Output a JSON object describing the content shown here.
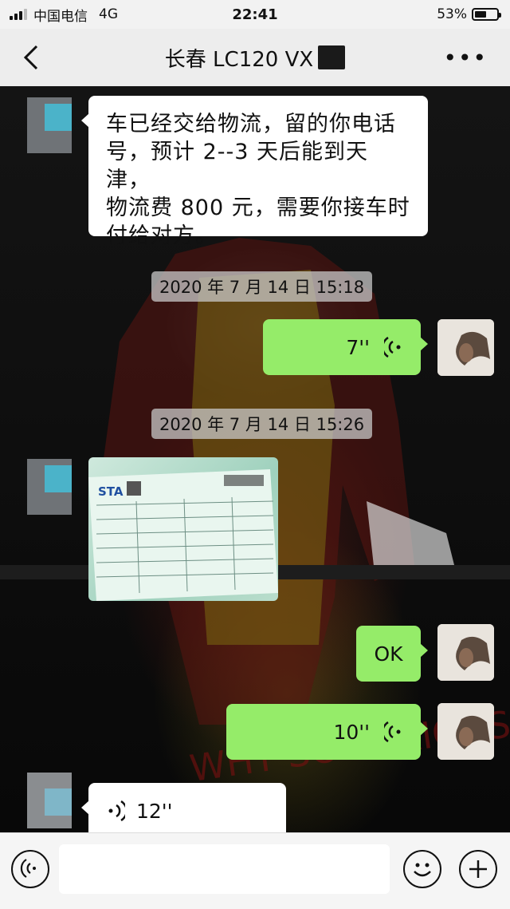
{
  "status_bar": {
    "carrier": "中国电信",
    "network": "4G",
    "time": "22:41",
    "battery": "53%",
    "battery_level": 0.53
  },
  "header": {
    "title": "长春 LC120 VX",
    "back_icon": "chevron-left-icon",
    "more_icon": "more-dots-icon",
    "more_text": "•••"
  },
  "messages": [
    {
      "type": "text",
      "side": "left",
      "text_lines": [
        "车已经交给物流，留的你电话",
        "号，预计 2--3 天后能到天津，",
        "物流费 800 元，需要你接车时",
        "付给对方。"
      ]
    },
    {
      "type": "timestamp",
      "text": "2020 年 7 月 14 日  15:18"
    },
    {
      "type": "voice",
      "side": "right",
      "duration": "7''"
    },
    {
      "type": "timestamp",
      "text": "2020 年 7 月 14 日  15:26"
    },
    {
      "type": "image",
      "side": "left",
      "description_icon": "logistics-receipt-photo"
    },
    {
      "type": "text",
      "side": "right",
      "text": "OK"
    },
    {
      "type": "voice",
      "side": "right",
      "duration": "10''"
    },
    {
      "type": "voice",
      "side": "left",
      "duration": "12''"
    }
  ],
  "input_bar": {
    "voice_icon": "voice-mode-icon",
    "emoji_icon": "emoji-icon",
    "plus_icon": "plus-icon"
  },
  "colors": {
    "green_bubble": "#95ec69",
    "white_bubble": "#ffffff",
    "header_bg": "#ededed"
  }
}
